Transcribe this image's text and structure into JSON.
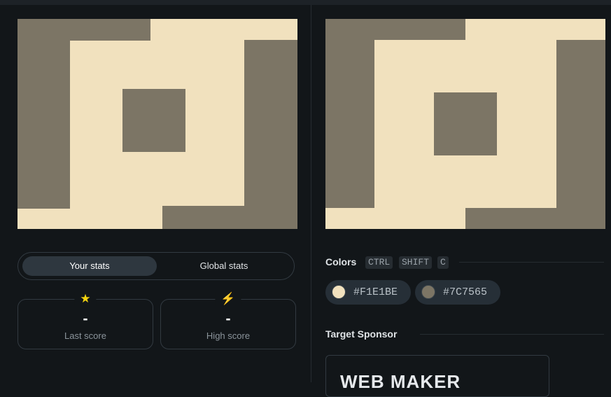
{
  "stats": {
    "tabs": [
      {
        "label": "Your stats",
        "active": true
      },
      {
        "label": "Global stats",
        "active": false
      }
    ],
    "cards": [
      {
        "icon": "star-icon",
        "glyph": "★",
        "value": "-",
        "label": "Last score"
      },
      {
        "icon": "lightning-icon",
        "glyph": "⚡",
        "value": "-",
        "label": "High score"
      }
    ]
  },
  "colors": {
    "title": "Colors",
    "shortcut": [
      "CTRL",
      "SHIFT",
      "C"
    ],
    "swatches": [
      {
        "hex": "#F1E1BE",
        "color": "#F1E1BE"
      },
      {
        "hex": "#7C7565",
        "color": "#7C7565"
      }
    ]
  },
  "sponsor": {
    "title": "Target Sponsor",
    "logo_text": "WEB MAKER"
  }
}
